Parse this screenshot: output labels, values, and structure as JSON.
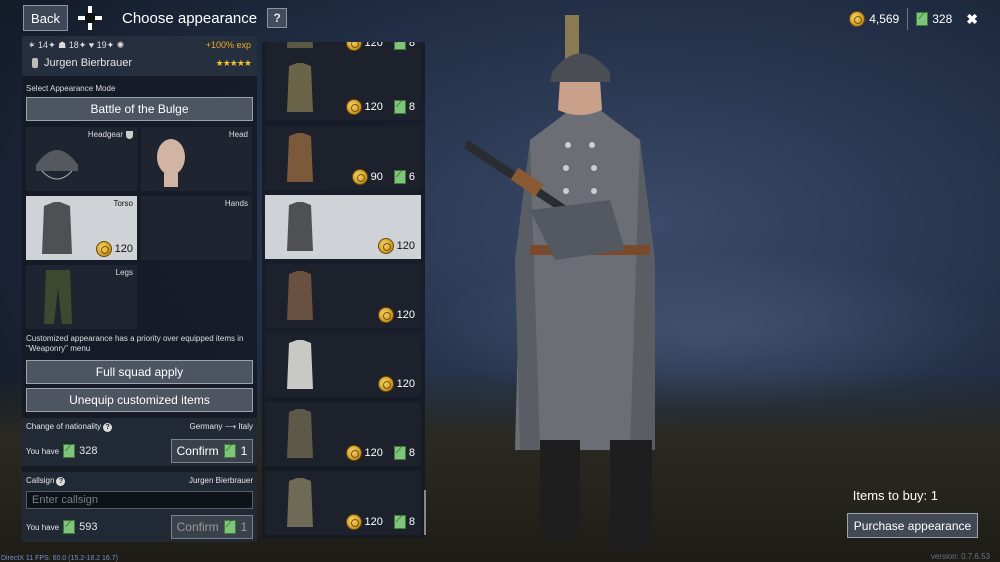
{
  "header": {
    "back_label": "Back",
    "title": "Choose appearance",
    "help_label": "?"
  },
  "currency": {
    "gold": "4,569",
    "tickets": "328",
    "close_label": "✖"
  },
  "player": {
    "stats": [
      "14",
      "18",
      "19"
    ],
    "exp_bonus": "+100% exp",
    "name": "Jurgen Bierbrauer",
    "stars": "★★★★★"
  },
  "appearance_mode": {
    "label": "Select Appearance Mode",
    "value": "Battle of the Bulge"
  },
  "slots": {
    "headgear": "Headgear",
    "head": "Head",
    "torso": "Torso",
    "torso_price": "120",
    "hands": "Hands",
    "legs": "Legs"
  },
  "note": "Customized appearance has a priority over equipped items in \"Weaponry\" menu",
  "buttons": {
    "full_squad": "Full squad apply",
    "unequip": "Unequip customized items"
  },
  "nationality": {
    "label": "Change of nationality",
    "route": "Germany ⟶ Italy",
    "you_have_label": "You have",
    "you_have_value": "328",
    "confirm_label": "Confirm",
    "confirm_cost": "1"
  },
  "callsign": {
    "label": "Callsign",
    "current": "Jurgen Bierbrauer",
    "placeholder": "Enter callsign",
    "you_have_label": "You have",
    "you_have_value": "593",
    "confirm_label": "Confirm",
    "confirm_cost": "1"
  },
  "items": [
    {
      "gold": "120",
      "tickets": "8",
      "color": "#5a5a46",
      "selected": false
    },
    {
      "gold": "120",
      "tickets": "8",
      "color": "#6a6448",
      "selected": false
    },
    {
      "gold": "90",
      "tickets": "6",
      "color": "#7a5a3a",
      "selected": false
    },
    {
      "gold": "120",
      "tickets": "",
      "color": "#4e5054",
      "selected": true
    },
    {
      "gold": "120",
      "tickets": "",
      "color": "#6a5040",
      "selected": false
    },
    {
      "gold": "120",
      "tickets": "",
      "color": "#c8c8c4",
      "selected": false
    },
    {
      "gold": "120",
      "tickets": "8",
      "color": "#5e5848",
      "selected": false
    },
    {
      "gold": "120",
      "tickets": "8",
      "color": "#6e6a56",
      "selected": false
    }
  ],
  "footer": {
    "items_to_buy": "Items to buy: 1",
    "purchase_label": "Purchase appearance",
    "fps": "DirectX 11 FPS: 60.0 (15.2-18.2 16.7)",
    "version": "version: 0.7.6.53"
  }
}
